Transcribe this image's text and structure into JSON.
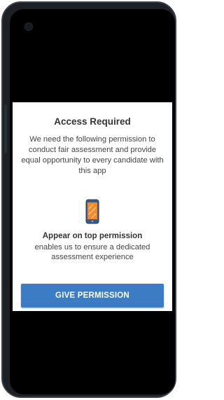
{
  "dialog": {
    "title": "Access Required",
    "message": "We need the following permission to conduct fair assessment and provide equal opportunity to every candidate with this app",
    "permission_icon": "phone-overlay-icon",
    "permission_title": "Appear on top permission",
    "permission_description": "enables us to ensure a dedicated assessment experience",
    "button_label": "GIVE PERMISSION"
  },
  "colors": {
    "accent": "#3b7cc4",
    "icon_fill": "#f08a2c",
    "device_frame": "#1d2126",
    "screen_background": "#000000"
  }
}
